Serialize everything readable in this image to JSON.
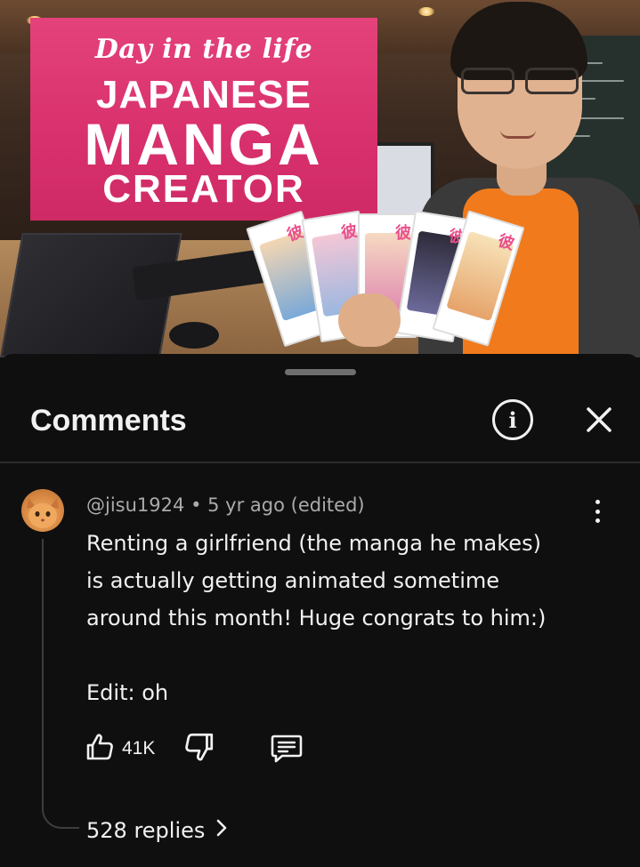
{
  "video": {
    "title_script": "Day in the life",
    "title_line1": "JAPANESE",
    "title_line2": "MANGA",
    "title_line3": "CREATOR"
  },
  "comments_panel": {
    "title": "Comments",
    "info_icon": "info-icon",
    "close_icon": "close-icon"
  },
  "comment": {
    "author": "@jisu1924",
    "separator": "•",
    "time": "5 yr ago (edited)",
    "body": "Renting a girlfriend (the manga he makes)\nis actually getting animated sometime\naround this month! Huge congrats to him:)\n\nEdit: oh",
    "like_count": "41K",
    "replies_label": "528 replies",
    "icons": {
      "like": "thumbs-up-icon",
      "dislike": "thumbs-down-icon",
      "reply": "comment-icon",
      "more": "more-vert-icon",
      "replies_chevron": "chevron-right-icon"
    }
  },
  "colors": {
    "background": "#0f0f0f",
    "text_primary": "#f1f1f1",
    "text_secondary": "#aaaaaa",
    "title_card": "#e0397a",
    "shirt": "#f07a1c"
  }
}
